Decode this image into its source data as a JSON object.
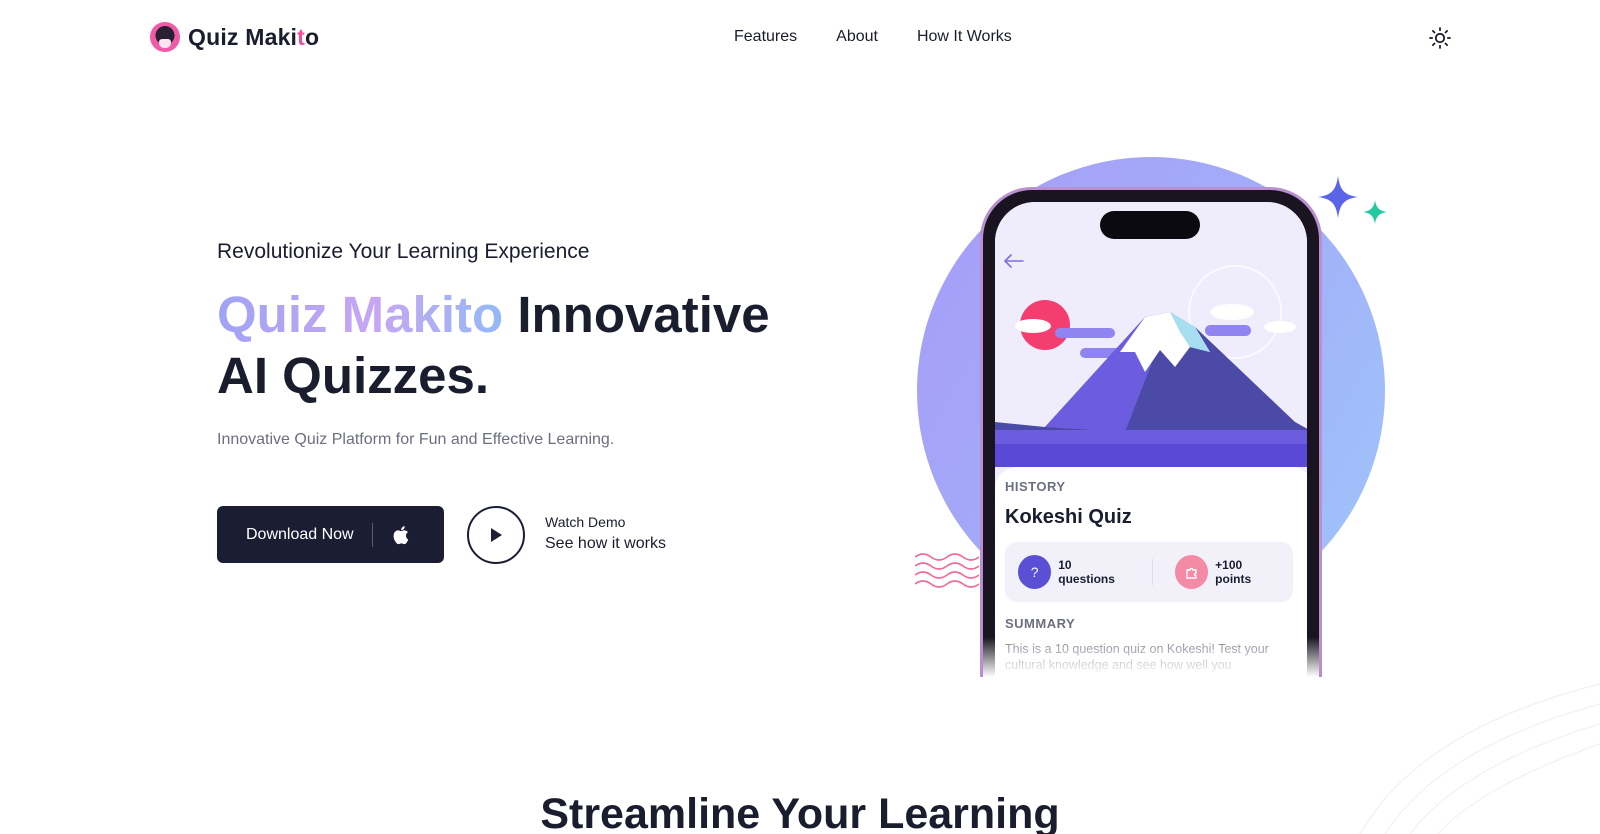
{
  "brand": {
    "name_main": "Quiz Maki",
    "name_accent": "t",
    "name_tail": "o"
  },
  "nav": {
    "items": [
      "Features",
      "About",
      "How It Works"
    ]
  },
  "hero": {
    "eyebrow": "Revolutionize Your Learning Experience",
    "headline_gradient": "Quiz Makito",
    "headline_rest": " Innovative AI Quizzes.",
    "subtext": "Innovative Quiz Platform for Fun and Effective Learning.",
    "cta_label": "Download Now",
    "demo_title": "Watch Demo",
    "demo_subtitle": "See how it works"
  },
  "phone_card": {
    "category": "HISTORY",
    "title": "Kokeshi Quiz",
    "questions": "10 questions",
    "points": "+100 points",
    "question_icon": "?",
    "summary_heading": "SUMMARY",
    "summary": "This is a 10 question quiz on Kokeshi! Test your cultural knowledge and see how well you"
  },
  "section": {
    "title": "Streamline Your Learning"
  },
  "colors": {
    "ink": "#1a1d2e",
    "accent_pink": "#ee4f9e",
    "cta_bg": "#1b1e33",
    "blob_start": "#a69cf9",
    "blob_end": "#9ec7fa",
    "sparkle_purple": "#5b63e8",
    "sparkle_teal": "#22c9a0"
  },
  "icons": [
    "logo-icon",
    "sun-icon",
    "apple-icon",
    "play-icon",
    "back-arrow-icon",
    "question-icon",
    "puzzle-icon",
    "sparkle-icon",
    "waves-icon"
  ]
}
